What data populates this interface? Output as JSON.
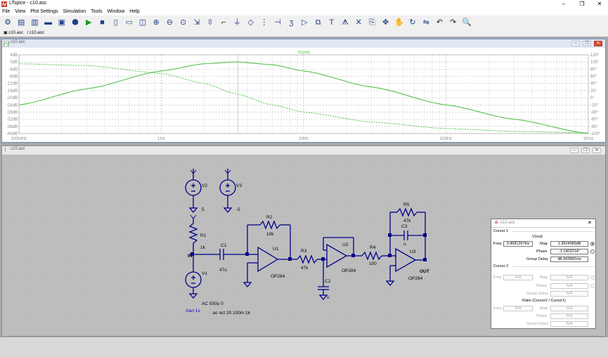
{
  "app": {
    "title": "LTspice - c10.asc",
    "window_controls": [
      "–",
      "❐",
      "✕"
    ]
  },
  "menu": [
    "File",
    "View",
    "Plot Settings",
    "Simulation",
    "Tools",
    "Window",
    "Help"
  ],
  "toolbar_icons": [
    "settings-icon",
    "open-icon",
    "open-examples-icon",
    "save-icon",
    "print-icon",
    "hammer-icon",
    "run-icon",
    "halt-icon",
    "tile-vertical-icon",
    "tile-horizontal-icon",
    "cascade-icon",
    "zoom-in-icon",
    "zoom-out-icon",
    "zoom-extents-icon",
    "autoscale-icon",
    "scale-icon",
    "wire-icon",
    "ground-icon",
    "net-label-icon",
    "resistor-icon",
    "capacitor-icon",
    "inductor-icon",
    "diode-icon",
    "component-icon",
    "text-icon",
    "spice-directive-icon",
    "delete-icon",
    "duplicate-icon",
    "move-icon",
    "drag-icon",
    "rotate-icon",
    "mirror-icon",
    "undo-icon",
    "redo-icon",
    "find-icon"
  ],
  "doc_tabs": [
    "c10.asc",
    "c10.asc"
  ],
  "plot_window": {
    "title": "c10.asc",
    "trace_label": "V(out)",
    "trace_color": "#55c050"
  },
  "schematic_window": {
    "title": "c10.asc"
  },
  "chart_data": {
    "type": "line",
    "title": "",
    "trace": "V(out)",
    "x_scale": "log",
    "xlim": [
      0.1,
      1000
    ],
    "x_ticks": [
      "100mHz",
      "1Hz",
      "10Hz",
      "100Hz",
      "1KHz"
    ],
    "y_left_ticks": [
      "4dB",
      "0dB",
      "-4dB",
      "-8dB",
      "-12dB",
      "-16dB",
      "-20dB",
      "-24dB",
      "-28dB",
      "-32dB",
      "-36dB",
      "-40dB"
    ],
    "y_left_lim": [
      -40,
      4
    ],
    "y_right_ticks": [
      "120°",
      "100°",
      "80°",
      "60°",
      "40°",
      "20°",
      "0°",
      "-20°",
      "-40°",
      "-60°",
      "-80°",
      "-100°"
    ],
    "y_right_lim": [
      -100,
      120
    ],
    "grid": true,
    "series": [
      {
        "name": "magnitude",
        "x": [
          0.1,
          0.3,
          1,
          2,
          3.4,
          6,
          10,
          30,
          100,
          300,
          1000
        ],
        "y": [
          -24,
          -15,
          -5,
          -1,
          0,
          -1.5,
          -5,
          -14,
          -24,
          -32,
          -40
        ]
      },
      {
        "name": "phase",
        "x": [
          0.1,
          0.3,
          1,
          2,
          3.4,
          6,
          10,
          30,
          100,
          300,
          1000
        ],
        "y": [
          95,
          90,
          68,
          40,
          10,
          -20,
          -40,
          -68,
          -86,
          -94,
          -98
        ]
      }
    ]
  },
  "schematic": {
    "components": {
      "V2": {
        "name": "V2",
        "value": "5"
      },
      "V3": {
        "name": "V3",
        "value": "-5"
      },
      "R1": {
        "name": "R1",
        "value": "1k"
      },
      "V1": {
        "name": "V1",
        "value": "AC 500u 0"
      },
      "C1": {
        "name": "C1",
        "value": "47u"
      },
      "R2": {
        "name": "R2",
        "value": "10k"
      },
      "U1": {
        "name": "U1",
        "value": "OP284"
      },
      "R3": {
        "name": "R3",
        "value": "47k"
      },
      "C2": {
        "name": "C2",
        "value": "u"
      },
      "U2": {
        "name": "U2",
        "value": "OP284"
      },
      "R4": {
        "name": "R4",
        "value": "100"
      },
      "R5": {
        "name": "R5",
        "value": "47k"
      },
      "C3": {
        "name": "C3",
        "value": "u"
      },
      "U3": {
        "name": "U3",
        "value": "OP284"
      }
    },
    "net_labels": {
      "in": "IN",
      "out": "OUT"
    },
    "directives": {
      "tran": ".tran 1s",
      "ac": ".ac oct 20 100m 1k"
    }
  },
  "cursor_dialog": {
    "title": "c10.asc",
    "cursor1": {
      "section": "Cursor 1",
      "trace": "V(out)",
      "freq_label": "Freq",
      "freq": "3.4581267Hz",
      "mag_label": "Mag",
      "mag": "1.3924589dB",
      "phase_label": "Phase",
      "phase": "-1.1402214°",
      "gd_label": "Group Delay",
      "group_delay": "48.043982ms"
    },
    "cursor2": {
      "section": "Cursor 2",
      "freq_label": "Freq",
      "freq": "N/A",
      "mag_label": "Mag",
      "mag": "N/A",
      "phase_label": "Phase",
      "phase": "N/A",
      "gd_label": "Group Delay",
      "group_delay": "N/A"
    },
    "ratio": {
      "section": "Ratio (Cursor2 / Cursor1)",
      "freq_label": "Freq",
      "freq": "N/A",
      "mag_label": "Mag",
      "mag": "N/A",
      "phase_label": "Phase",
      "phase": "N/A",
      "gd_label": "Group Delay",
      "group_delay": "N/A"
    }
  }
}
